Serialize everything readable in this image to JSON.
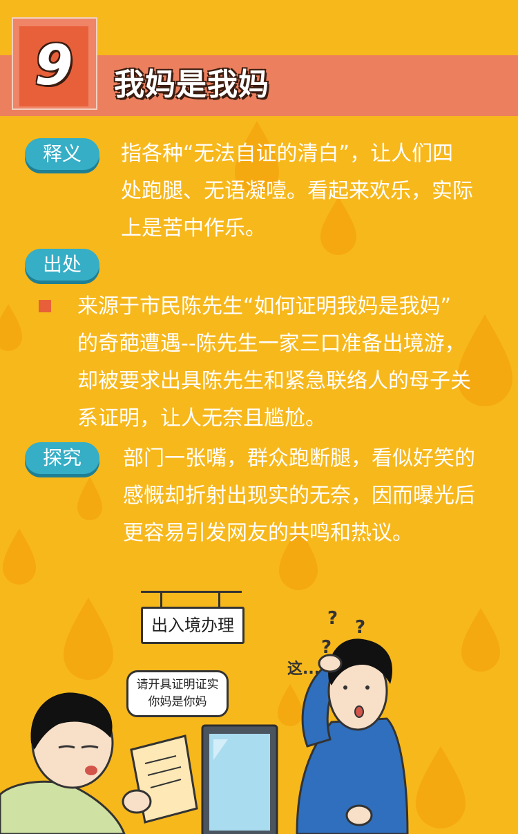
{
  "header": {
    "number": "9",
    "title": "我妈是我妈"
  },
  "sections": {
    "definition": {
      "label": "释义",
      "lines": [
        "指各种“无法自证的清白”，让人们四",
        "处跑腿、无语凝噎。看起来欢乐，实际",
        "上是苦中作乐。"
      ]
    },
    "origin": {
      "label": "出处",
      "lines": [
        "来源于市民陈先生“如何证明我妈是我妈”",
        "的奇葩遭遇--陈先生一家三口准备出境游，",
        "却被要求出具陈先生和紧急联络人的母子关",
        "系证明，让人无奈且尴尬。"
      ]
    },
    "analysis": {
      "label": "探究",
      "lines": [
        "部门一张嘴，群众跑断腿，看似好笑的",
        "感慨却折射出现实的无奈，因而曝光后",
        "更容易引发网友的共鸣和热议。"
      ]
    }
  },
  "illustration": {
    "sign": "出入境办理",
    "speech_lines": [
      "请开具证明证实",
      "你妈是你妈"
    ],
    "question_marks": [
      "?",
      "?",
      "?"
    ],
    "exclamation": "这..."
  },
  "colors": {
    "background": "#f7b81c",
    "header_bar": "#ec7f5e",
    "number_box": "#e8603a",
    "pill": "#35aec6"
  }
}
